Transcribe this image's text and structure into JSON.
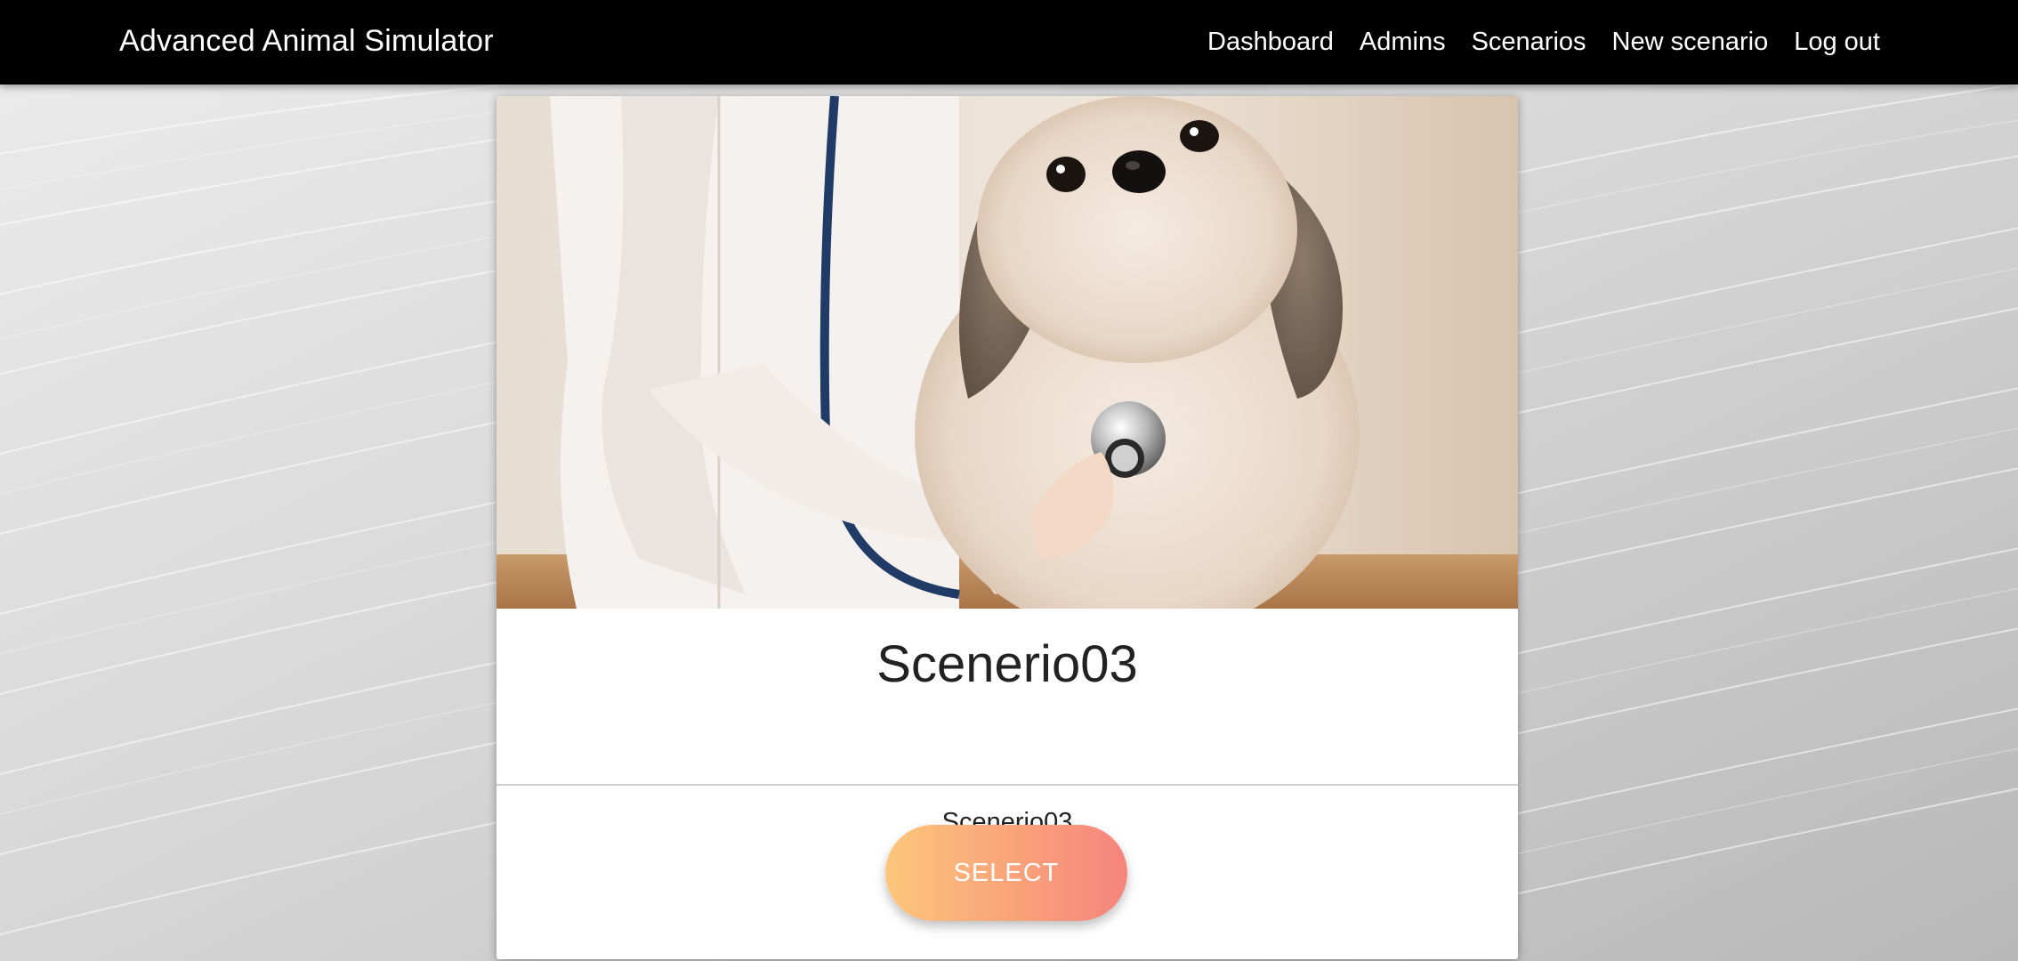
{
  "navbar": {
    "brand": "Advanced Animal Simulator",
    "links": [
      "Dashboard",
      "Admins",
      "Scenarios",
      "New scenario",
      "Log out"
    ]
  },
  "card": {
    "image": "vet-examining-dog-photo",
    "title": "Scenerio03",
    "subtitle": "Scenerio03",
    "select_label": "SELECT"
  },
  "colors": {
    "navbar_bg": "#000000",
    "button_gradient_start": "#fdc67b",
    "button_gradient_end": "#f6847c"
  }
}
